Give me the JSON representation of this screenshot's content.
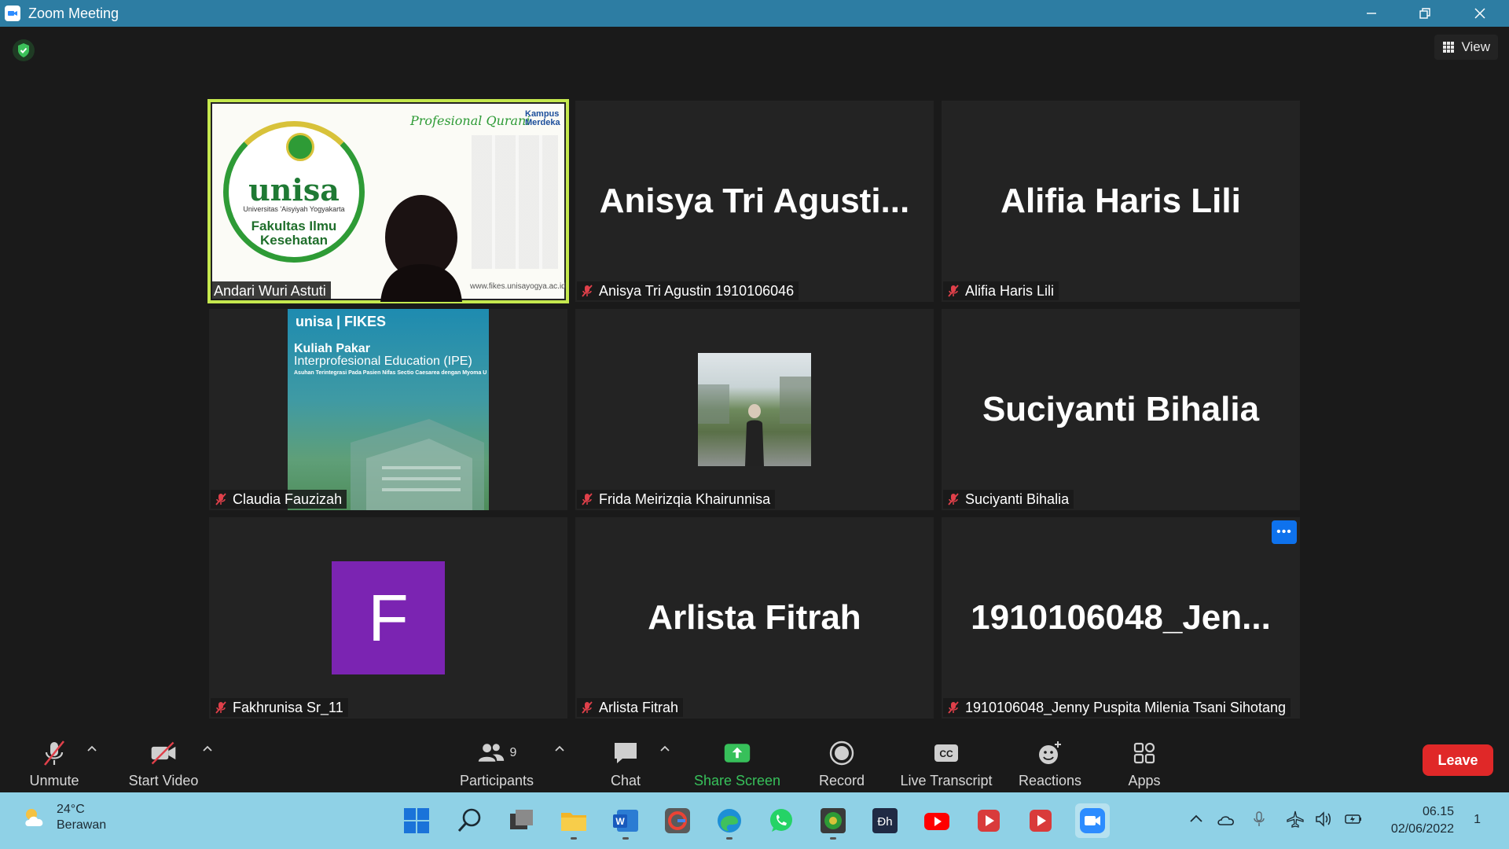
{
  "window": {
    "title": "Zoom Meeting"
  },
  "view_label": "View",
  "tiles": [
    {
      "name": "Andari Wuri Astuti",
      "muted": false,
      "kind": "slide-unisa"
    },
    {
      "display": "Anisya Tri Agusti...",
      "name": "Anisya Tri Agustin 1910106046",
      "muted": true
    },
    {
      "display": "Alifia Haris Lili",
      "name": "Alifia Haris Lili",
      "muted": true
    },
    {
      "name": "Claudia Fauzizah",
      "muted": true,
      "kind": "slide-kuliah"
    },
    {
      "name": "Frida Meirizqia Khairunnisa",
      "muted": true,
      "kind": "photo"
    },
    {
      "display": "Suciyanti Bihalia",
      "name": "Suciyanti Bihalia",
      "muted": true
    },
    {
      "avatar": "F",
      "name": "Fakhrunisa Sr_11",
      "muted": true
    },
    {
      "display": "Arlista Fitrah",
      "name": "Arlista Fitrah",
      "muted": true
    },
    {
      "display": "1910106048_Jen...",
      "name": "1910106048_Jenny Puspita Milenia Tsani Sihotang",
      "muted": true
    }
  ],
  "slide1": {
    "logo": "unisa",
    "university": "Universitas 'Aisyiyah Yogyakarta",
    "faculty_line1": "Fakultas Ilmu",
    "faculty_line2": "Kesehatan",
    "tagline": "Profesional Qurani",
    "kampus_line1": "Kampus",
    "kampus_line2": "Merdeka",
    "url": "www.fikes.unisayogya.ac.id"
  },
  "slide2": {
    "header": "unisa | FIKES",
    "title": "Kuliah Pakar",
    "subtitle": "Interprofesional Education (IPE)",
    "detail": "Asuhan Terintegrasi Pada Pasien Nifas Sectio Caesarea dengan Myoma U"
  },
  "toolbar": {
    "unmute": "Unmute",
    "start_video": "Start Video",
    "participants": "Participants",
    "participants_count": "9",
    "chat": "Chat",
    "share_screen": "Share Screen",
    "record": "Record",
    "live_transcript": "Live Transcript",
    "reactions": "Reactions",
    "apps": "Apps",
    "leave": "Leave"
  },
  "taskbar": {
    "temperature": "24°C",
    "condition": "Berawan",
    "time": "06.15",
    "date": "02/06/2022",
    "notifications": "1"
  },
  "colors": {
    "titlebar": "#2d7da3",
    "active_speaker": "#c5e84e",
    "share_green": "#37c05a",
    "leave_red": "#e02828",
    "avatar_purple": "#7b24b2",
    "taskbar": "#8fd1e6"
  }
}
